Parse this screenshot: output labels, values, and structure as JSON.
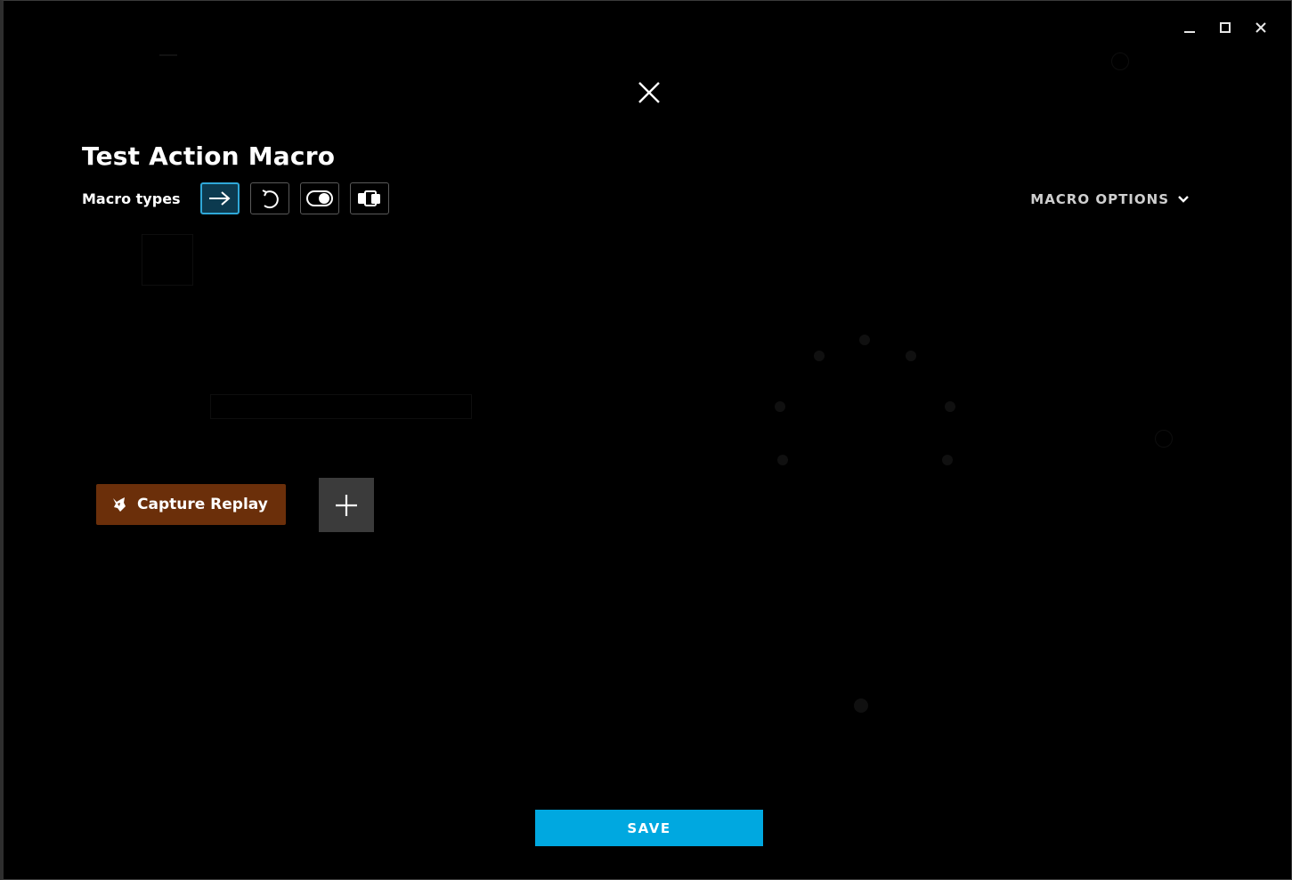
{
  "window": {
    "minimize_icon": "minimize-icon",
    "maximize_icon": "maximize-icon",
    "close_icon": "close-icon"
  },
  "overlay": {
    "close_icon": "close-icon"
  },
  "macro": {
    "title": "Test Action Macro",
    "types_label": "Macro types",
    "types": [
      {
        "icon": "arrow-right-icon",
        "active": true
      },
      {
        "icon": "repeat-icon",
        "active": false
      },
      {
        "icon": "toggle-icon",
        "active": false
      },
      {
        "icon": "sequence-icon",
        "active": false
      }
    ],
    "options_label": "MACRO OPTIONS"
  },
  "actions": {
    "capture_replay_label": "Capture Replay",
    "capture_replay_icon": "fox-icon",
    "add_icon": "plus-icon"
  },
  "footer": {
    "save_label": "SAVE"
  },
  "colors": {
    "accent_blue": "#00a8e0",
    "active_type_border": "#2fa8d8",
    "capture_replay_bg": "#6b2f0a",
    "add_button_bg": "#3b3b3b"
  }
}
